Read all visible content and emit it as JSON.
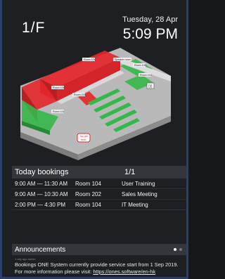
{
  "header": {
    "floor": "1/F",
    "date": "Tuesday, 28 Apr",
    "time": "5:09 PM"
  },
  "floorplan": {
    "rooms": [
      "Room 104",
      "Room 103",
      "Room 101",
      "Room 106",
      "Room 105",
      "Room 102",
      "Speaker room"
    ],
    "pin_label": "You are here",
    "colors": {
      "booked": "#e5262b",
      "available": "#35b84a",
      "corridor": "#9a9a9a",
      "wall": "#d8d8d8"
    }
  },
  "bookings": {
    "title": "Today bookings",
    "page": "1/1",
    "rows": [
      {
        "time": "9:00 AM — 11:30 AM",
        "room": "Room 104",
        "title": "User Training"
      },
      {
        "time": "9:00 AM — 10:30 AM",
        "room": "Room 202",
        "title": "Sales Meeting"
      },
      {
        "time": "2:00 PM — 4:30 PM",
        "room": "Room 104",
        "title": "IT Meeting"
      }
    ]
  },
  "announcements": {
    "title": "Announcements",
    "meta": "1 day ago  admin",
    "text_line1": "Bookings ONE System currently provide service start from 1 Sep 2019.",
    "text_line2_prefix": "For more information please visit: ",
    "link": "https://ones.software/en-hk"
  }
}
